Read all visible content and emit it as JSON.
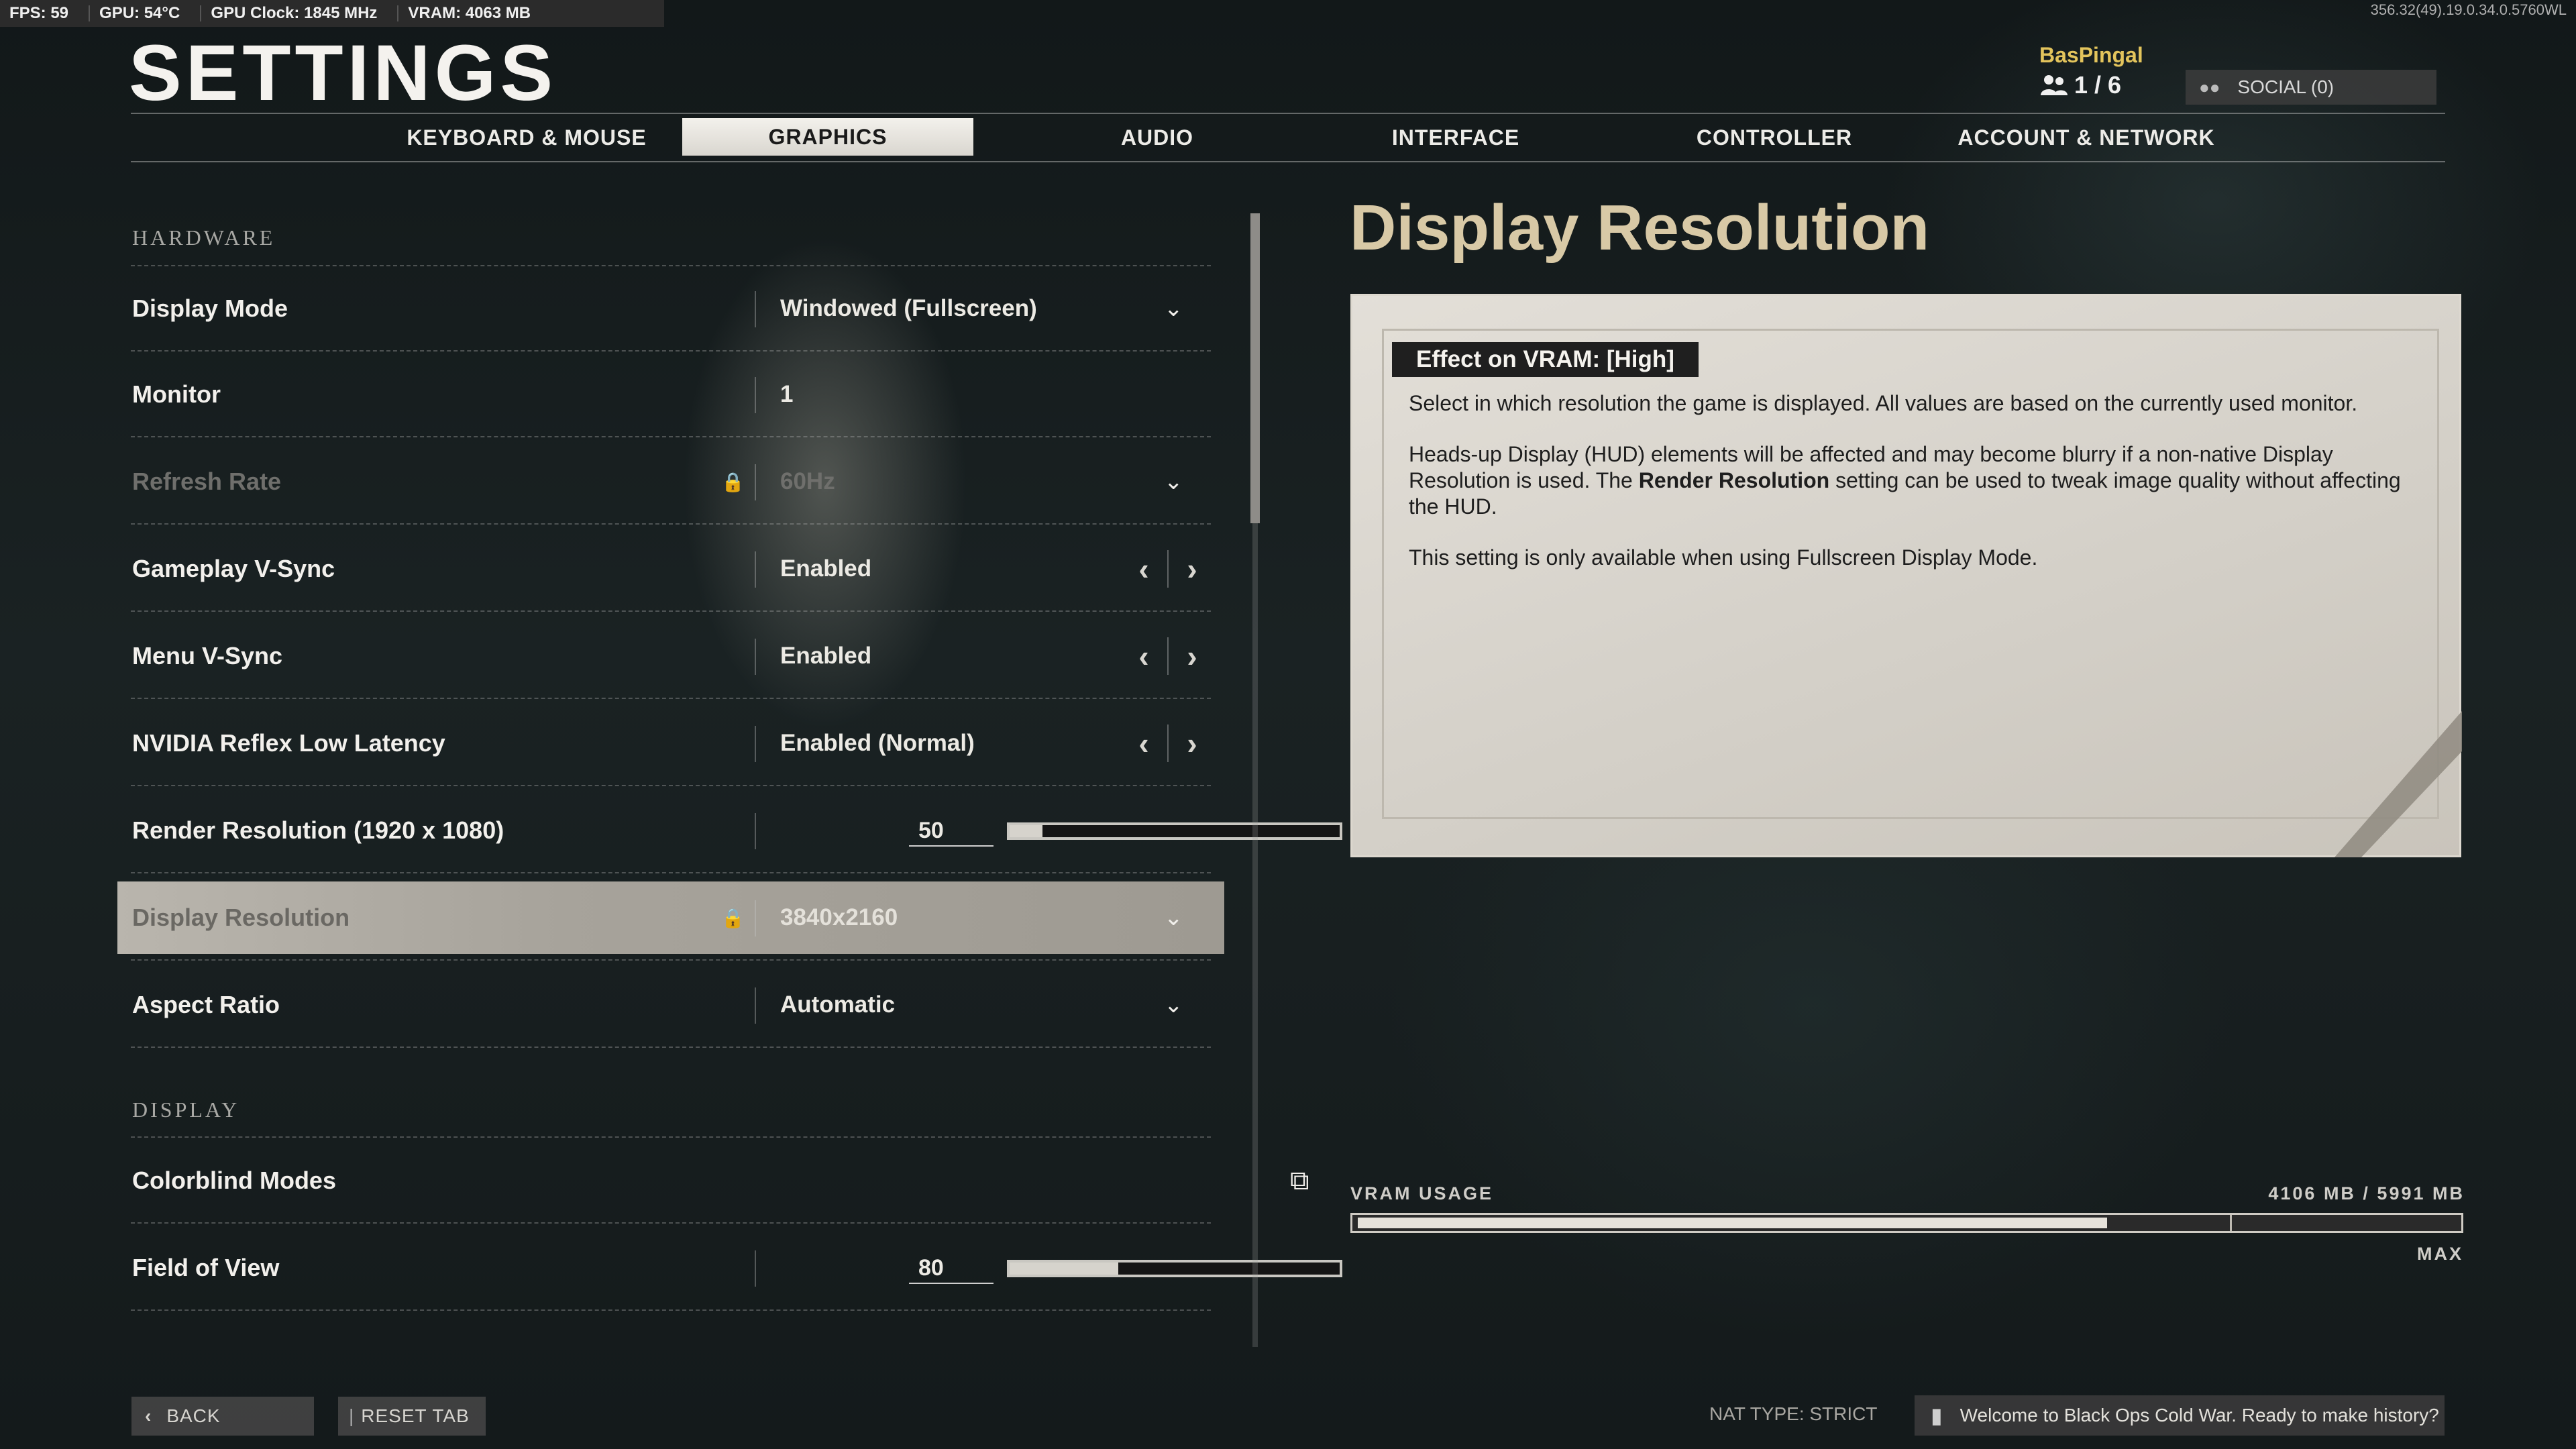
{
  "stats": {
    "fps": "FPS: 59",
    "gpu_temp": "GPU: 54°C",
    "gpu_clock": "GPU Clock: 1845 MHz",
    "vram": "VRAM: 4063 MB"
  },
  "build": "356.32(49).19.0.34.0.5760WL",
  "page_title": "SETTINGS",
  "user": {
    "name": "BasPingal",
    "party": "1 / 6"
  },
  "social_label": "SOCIAL (0)",
  "tabs": [
    "KEYBOARD & MOUSE",
    "GRAPHICS",
    "AUDIO",
    "INTERFACE",
    "CONTROLLER",
    "ACCOUNT & NETWORK"
  ],
  "active_tab": "GRAPHICS",
  "sections": {
    "hardware": "HARDWARE",
    "display": "DISPLAY"
  },
  "settings": {
    "display_mode": {
      "label": "Display Mode",
      "value": "Windowed (Fullscreen)"
    },
    "monitor": {
      "label": "Monitor",
      "value": "1"
    },
    "refresh_rate": {
      "label": "Refresh Rate",
      "value": "60Hz"
    },
    "gameplay_vsync": {
      "label": "Gameplay V-Sync",
      "value": "Enabled"
    },
    "menu_vsync": {
      "label": "Menu V-Sync",
      "value": "Enabled"
    },
    "reflex": {
      "label": "NVIDIA Reflex Low Latency",
      "value": "Enabled (Normal)"
    },
    "render_resolution": {
      "label": "Render Resolution (1920 x 1080)",
      "value": "50",
      "level": 0.1
    },
    "display_resolution": {
      "label": "Display Resolution",
      "value": "3840x2160"
    },
    "aspect_ratio": {
      "label": "Aspect Ratio",
      "value": "Automatic"
    },
    "colorblind": {
      "label": "Colorblind Modes"
    },
    "fov": {
      "label": "Field of View",
      "value": "80",
      "level": 0.33
    }
  },
  "info": {
    "title": "Display Resolution",
    "badge": "Effect on VRAM: [High]",
    "para1": "Select in which resolution the game is displayed. All values are based on the currently used monitor.",
    "para2_a": "Heads-up Display (HUD) elements will be affected and may become blurry if a non-native Display Resolution is used. The ",
    "para2_bold": "Render Resolution",
    "para2_b": " setting can be used to tweak image quality without affecting the HUD.",
    "para3": "This setting is only available when using Fullscreen Display Mode."
  },
  "vram": {
    "label": "VRAM USAGE",
    "value": "4106 MB / 5991 MB",
    "used_fraction": 0.685,
    "max_label": "MAX"
  },
  "bottom": {
    "back": "BACK",
    "reset": "RESET TAB",
    "nat": "NAT TYPE: STRICT",
    "chat": "Welcome to Black Ops Cold War. Ready to make history?"
  }
}
